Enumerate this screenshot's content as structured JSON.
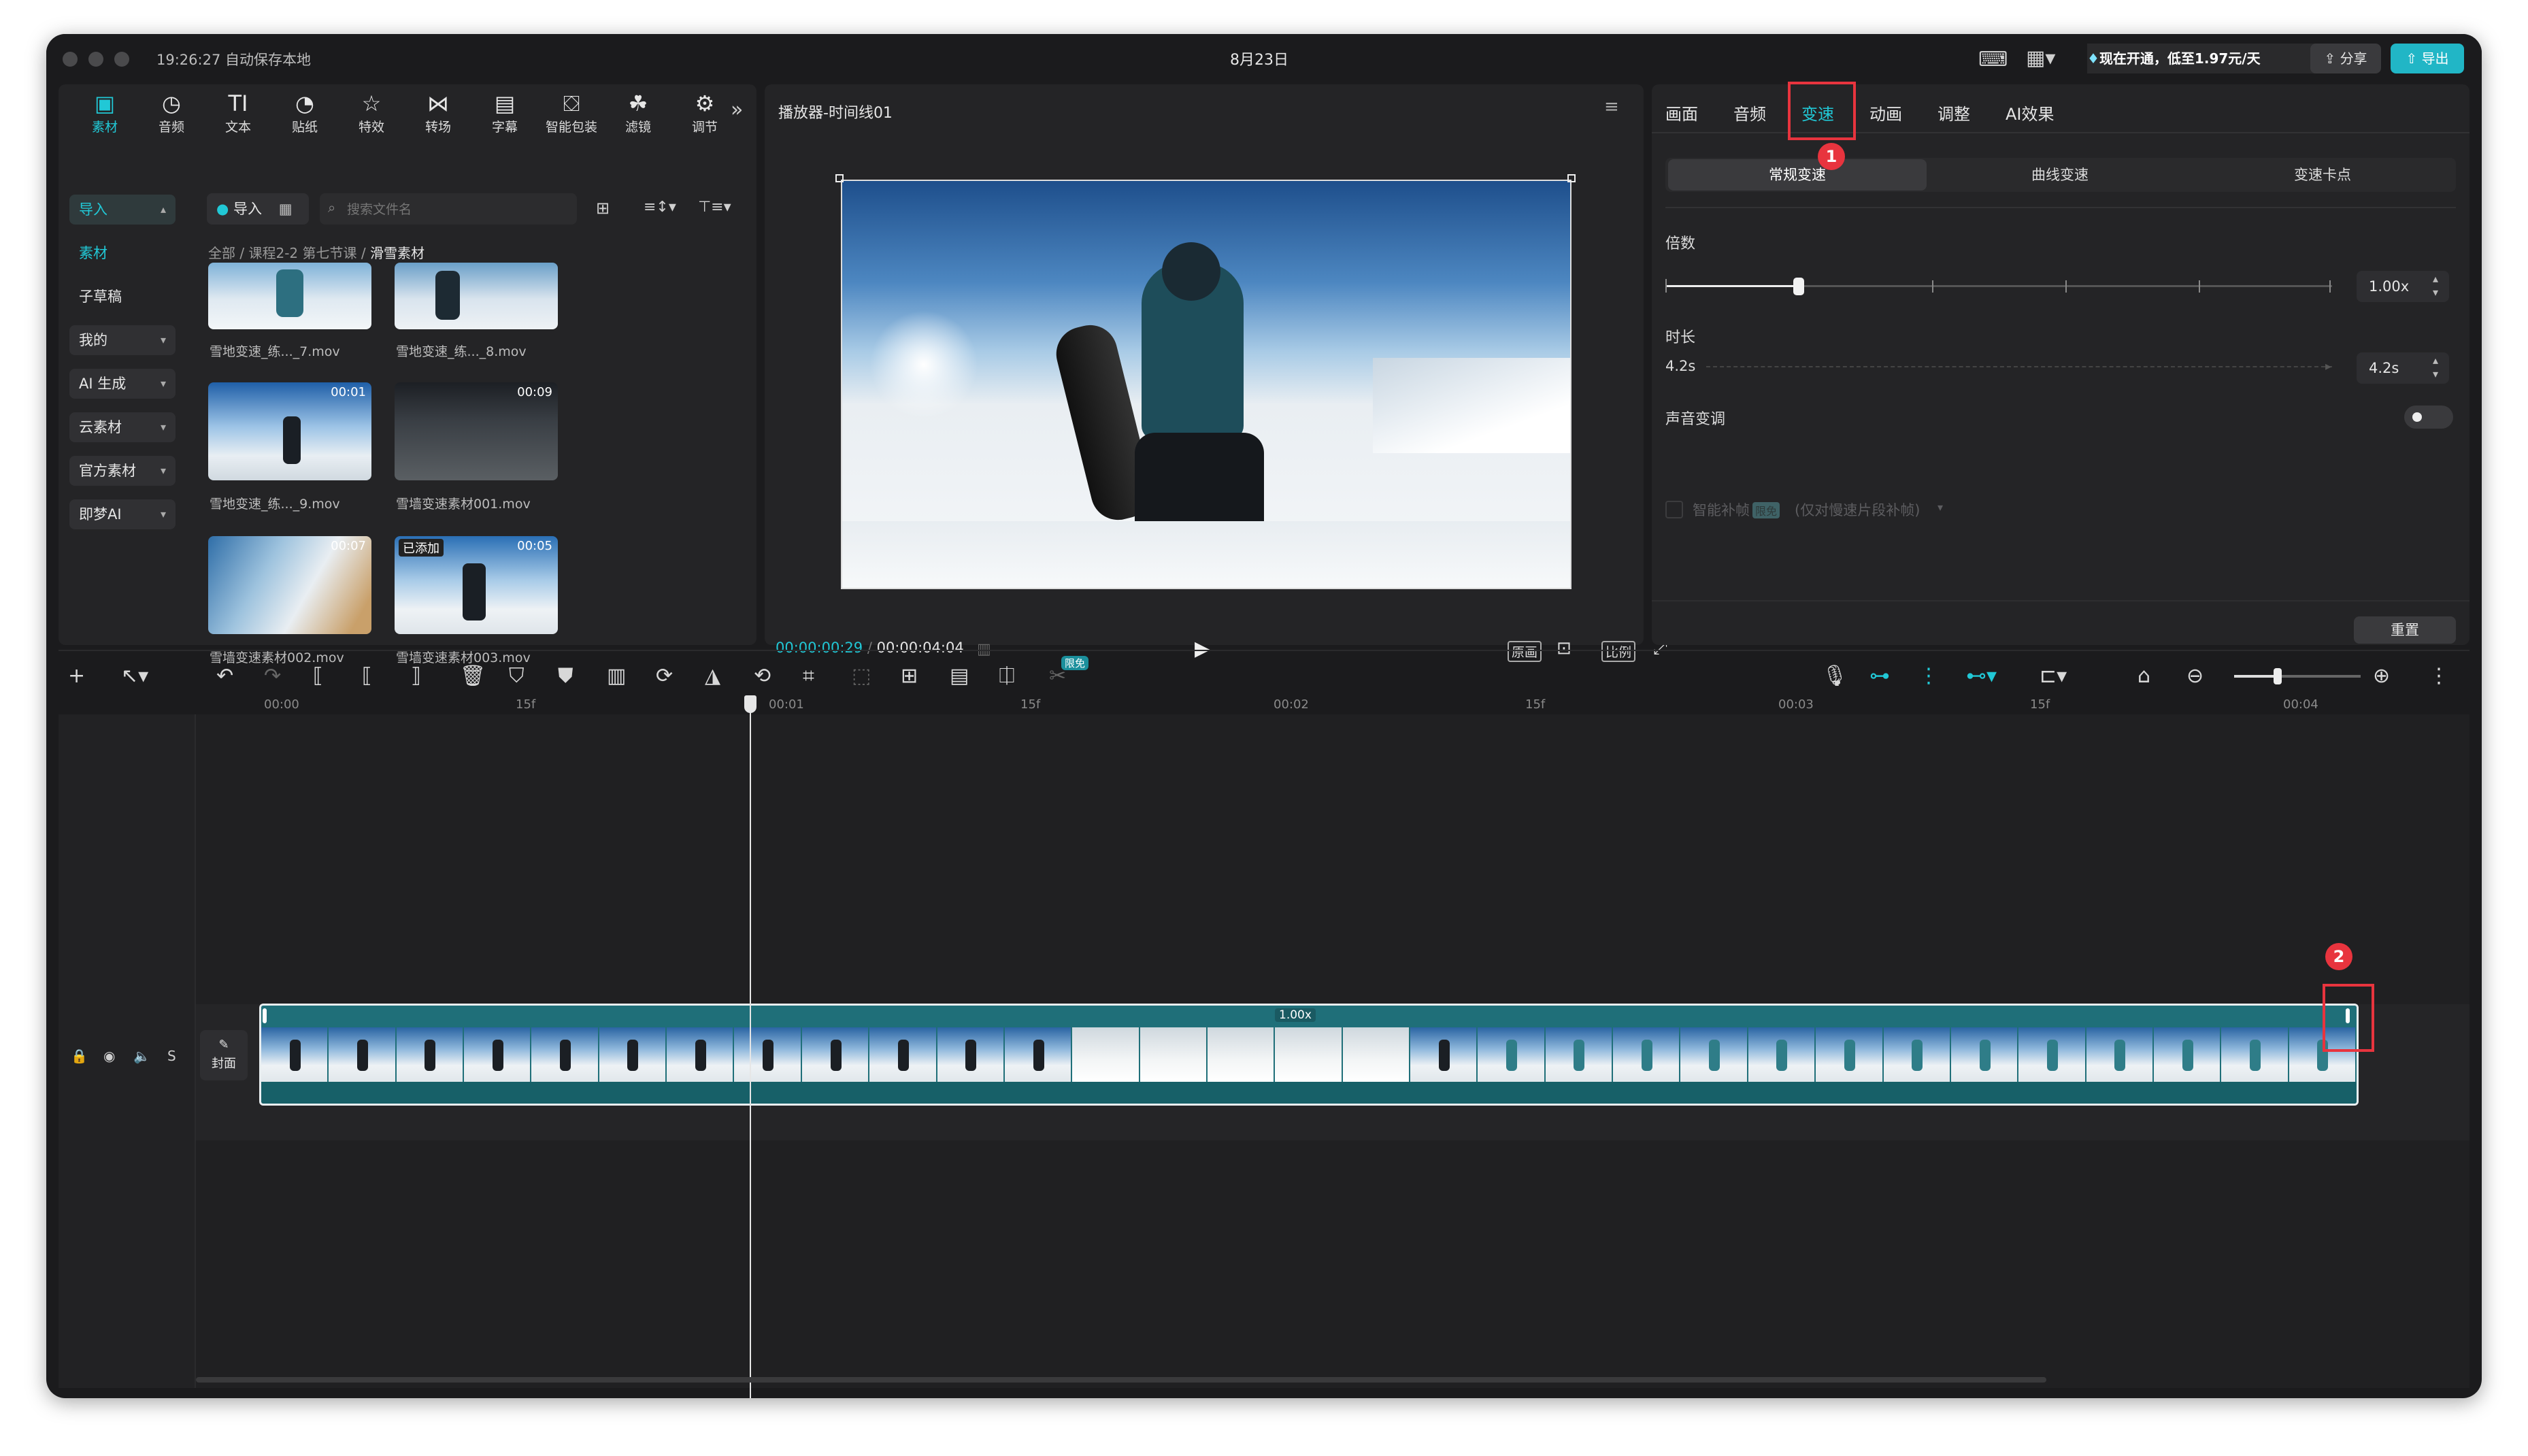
{
  "titlebar": {
    "autosave": "19:26:27 自动保存本地",
    "title": "8月23日",
    "promo": "现在开通，低至1.97元/天",
    "share": "分享",
    "export": "导出"
  },
  "toolbar": {
    "items": [
      {
        "label": "素材",
        "icon": "media-icon"
      },
      {
        "label": "音频",
        "icon": "audio-icon"
      },
      {
        "label": "文本",
        "icon": "text-icon"
      },
      {
        "label": "贴纸",
        "icon": "sticker-icon"
      },
      {
        "label": "特效",
        "icon": "effects-icon"
      },
      {
        "label": "转场",
        "icon": "transition-icon"
      },
      {
        "label": "字幕",
        "icon": "subtitle-icon"
      },
      {
        "label": "智能包装",
        "icon": "smart-package-icon"
      },
      {
        "label": "滤镜",
        "icon": "filter-icon"
      },
      {
        "label": "调节",
        "icon": "adjust-icon"
      }
    ]
  },
  "sidebar": {
    "items": [
      {
        "label": "导入",
        "active": true
      },
      {
        "label": "素材"
      },
      {
        "label": "子草稿"
      },
      {
        "label": "我的"
      },
      {
        "label": "AI 生成"
      },
      {
        "label": "云素材"
      },
      {
        "label": "官方素材"
      },
      {
        "label": "即梦AI"
      }
    ]
  },
  "media": {
    "import_label": "导入",
    "search_placeholder": "搜索文件名",
    "breadcrumb": [
      "全部",
      "课程2-2 第七节课",
      "滑雪素材"
    ],
    "clips": [
      {
        "name": "雪地变速_练..._7.mov",
        "duration": ""
      },
      {
        "name": "雪地变速_练..._8.mov",
        "duration": ""
      },
      {
        "name": "雪地变速_练..._9.mov",
        "duration": "00:01"
      },
      {
        "name": "雪墙变速素材001.mov",
        "duration": "00:09"
      },
      {
        "name": "雪墙变速素材002.mov",
        "duration": "00:07"
      },
      {
        "name": "雪墙变速素材003.mov",
        "duration": "00:05",
        "tag": "已添加"
      }
    ]
  },
  "player": {
    "title": "播放器-时间线01",
    "current_time": "00:00:00:29",
    "total_time": "00:00:04:04",
    "btn_original": "原画",
    "btn_ratio": "比例"
  },
  "inspector": {
    "tabs": [
      "画面",
      "音频",
      "变速",
      "动画",
      "调整",
      "AI效果"
    ],
    "active_tab": "变速",
    "segments": [
      "常规变速",
      "曲线变速",
      "变速卡点"
    ],
    "speed_label": "倍数",
    "speed_value": "1.00x",
    "speed_level": 0.2,
    "duration_label": "时长",
    "duration_left": "4.2s",
    "duration_value": "4.2s",
    "pitch_label": "声音变调",
    "smart_frame_label": "智能补帧",
    "smart_frame_badge": "限免",
    "smart_frame_hint": "(仅对慢速片段补帧)",
    "reset_label": "重置"
  },
  "timeline": {
    "ticks": [
      "00:00",
      "15f",
      "00:01",
      "15f",
      "00:02",
      "15f",
      "00:03",
      "15f",
      "00:04"
    ],
    "clip_speed": "1.00x",
    "cover_label": "封面",
    "limited_badge": "限免"
  },
  "annotations": [
    "1",
    "2"
  ],
  "colors": {
    "accent": "#21c8d6",
    "highlight": "#e8343e",
    "clip": "#1f6f79"
  }
}
